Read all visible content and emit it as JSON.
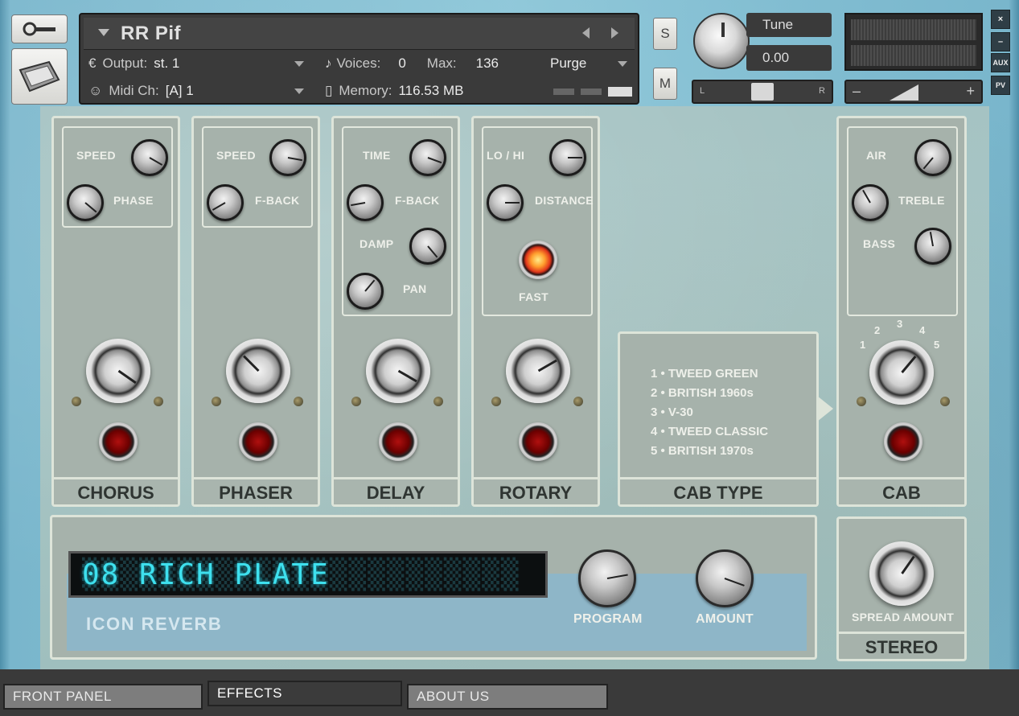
{
  "header": {
    "instrument_name": "RR Pif",
    "output_label": "Output:",
    "output_value": "st. 1",
    "midi_label": "Midi Ch:",
    "midi_value": "[A]  1",
    "voices_label": "Voices:",
    "voices_value": "0",
    "max_label": "Max:",
    "max_value": "136",
    "memory_label": "Memory:",
    "memory_value": "116.53 MB",
    "purge_label": "Purge",
    "solo_label": "S",
    "mute_label": "M",
    "tune_label": "Tune",
    "tune_value": "0.00",
    "pan_left": "L",
    "pan_right": "R",
    "vol_minus": "–",
    "vol_plus": "+"
  },
  "side_buttons": {
    "close": "×",
    "minimize": "–",
    "aux": "AUX",
    "pv": "PV"
  },
  "modules": {
    "chorus": {
      "title": "CHORUS",
      "p1": "SPEED",
      "p2": "PHASE"
    },
    "phaser": {
      "title": "PHASER",
      "p1": "SPEED",
      "p2": "F-BACK"
    },
    "delay": {
      "title": "DELAY",
      "p1": "TIME",
      "p2": "F-BACK",
      "p3": "DAMP",
      "p4": "PAN"
    },
    "rotary": {
      "title": "ROTARY",
      "p1": "LO / HI",
      "p2": "DISTANCE",
      "p3": "FAST"
    },
    "cabtype": {
      "title": "CAB TYPE",
      "items": [
        "1 • TWEED GREEN",
        "2 • BRITISH 1960s",
        "3 • V-30",
        "4 • TWEED CLASSIC",
        "5 • BRITISH 1970s"
      ]
    },
    "cab": {
      "title": "CAB",
      "p1": "AIR",
      "p2": "TREBLE",
      "p3": "BASS",
      "nums": [
        "1",
        "2",
        "3",
        "4",
        "5"
      ]
    }
  },
  "reverb": {
    "display_text": "08 RICH PLATE",
    "title": "ICON REVERB",
    "program_label": "PROGRAM",
    "amount_label": "AMOUNT"
  },
  "stereo": {
    "title": "STEREO",
    "spread_label": "SPREAD AMOUNT"
  },
  "tabs": [
    "FRONT PANEL",
    "EFFECTS",
    "ABOUT US"
  ],
  "active_tab": "EFFECTS"
}
